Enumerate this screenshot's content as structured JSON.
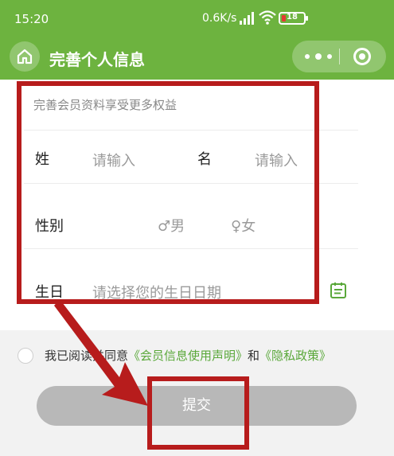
{
  "status_bar": {
    "time": "15:20",
    "net_speed": "0.6K/s",
    "signal": "4G",
    "battery": "18",
    "battery_level": 0.18,
    "battery_color": "#e53935"
  },
  "nav": {
    "title": "完善个人信息",
    "theme_color": "#6db33f"
  },
  "form": {
    "hint": "完善会员资料享受更多权益",
    "last_name_label": "姓",
    "last_name_placeholder": "请输入",
    "first_name_label": "名",
    "first_name_placeholder": "请输入",
    "gender_label": "性别",
    "gender_male_symbol": "♂",
    "gender_male": "男",
    "gender_female_symbol": "♀",
    "gender_female": "女",
    "birthday_label": "生日",
    "birthday_placeholder": "请选择您的生日日期"
  },
  "agreement": {
    "prefix": "我已阅读并同意",
    "link1": "《会员信息使用声明》",
    "middle": "和",
    "link2": "《隐私政策》",
    "link_color": "#5aa83a"
  },
  "submit_label": "提交",
  "annotation_color": "#b71c1c"
}
